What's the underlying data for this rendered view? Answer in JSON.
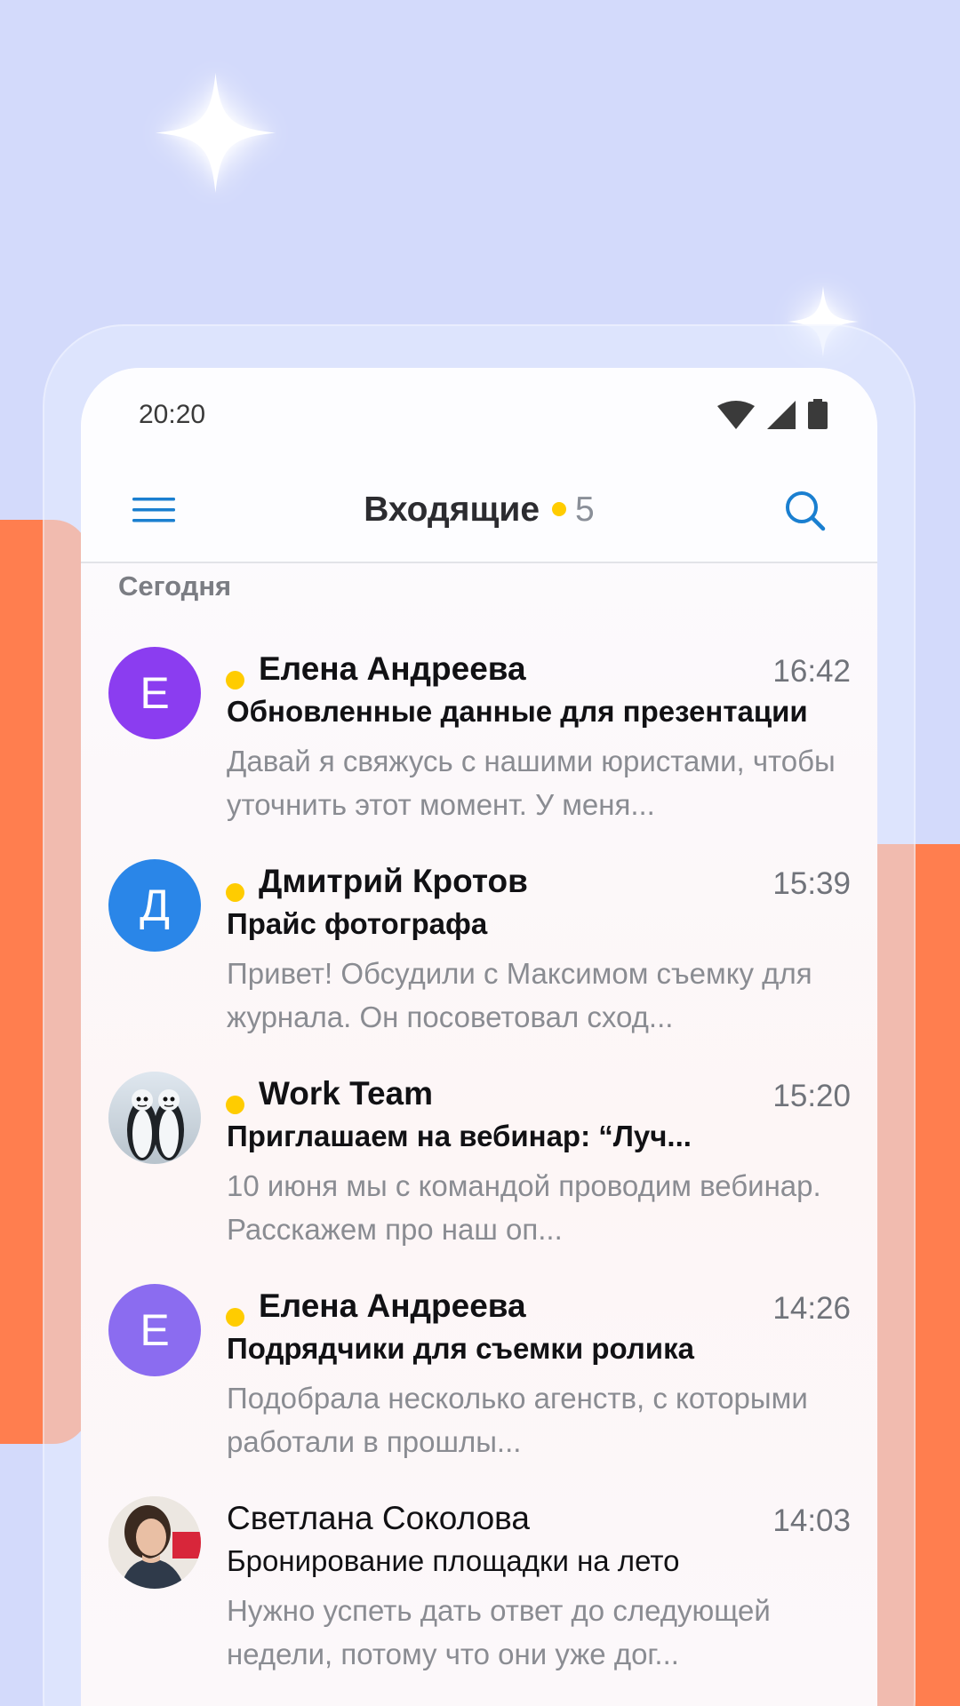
{
  "status_bar": {
    "time": "20:20"
  },
  "toolbar": {
    "title": "Входящие",
    "unread_count": "5"
  },
  "section": {
    "label": "Сегодня"
  },
  "messages": [
    {
      "sender": "Елена Андреева",
      "time": "16:42",
      "subject": "Обновленные данные для презентации",
      "preview": "Давай я свяжусь с нашими юристами, чтобы уточнить этот момент. У меня...",
      "avatar_letter": "Е",
      "avatar_color": "#8b3df0",
      "unread": true
    },
    {
      "sender": "Дмитрий Кротов",
      "time": "15:39",
      "subject": "Прайс фотографа",
      "preview": "Привет! Обсудили с Максимом съемку для журнала. Он посоветовал сход...",
      "avatar_letter": "Д",
      "avatar_color": "#2a86e8",
      "unread": true
    },
    {
      "sender": "Work Team",
      "time": "15:20",
      "subject": "Приглашаем на вебинар: “Луч...",
      "preview": "10 июня мы с командой проводим вебинар. Расскажем про наш оп...",
      "avatar_icon": "penguins-photo",
      "unread": true
    },
    {
      "sender": "Елена Андреева",
      "time": "14:26",
      "subject": "Подрядчики для съемки ролика",
      "preview": "Подобрала несколько агенств, с которыми работали в прошлы...",
      "avatar_letter": "Е",
      "avatar_color": "#8b6cf0",
      "unread": true
    },
    {
      "sender": "Светлана Соколова",
      "time": "14:03",
      "subject": "Бронирование площадки на лето",
      "preview": "Нужно успеть дать ответ до следующей недели, потому что они уже дог...",
      "avatar_icon": "woman-photo",
      "unread": false
    }
  ],
  "colors": {
    "background": "#d3dafb",
    "accent_orange": "#ff7e4f",
    "unread_dot": "#ffcc00",
    "icon_blue": "#1a7fd0"
  }
}
